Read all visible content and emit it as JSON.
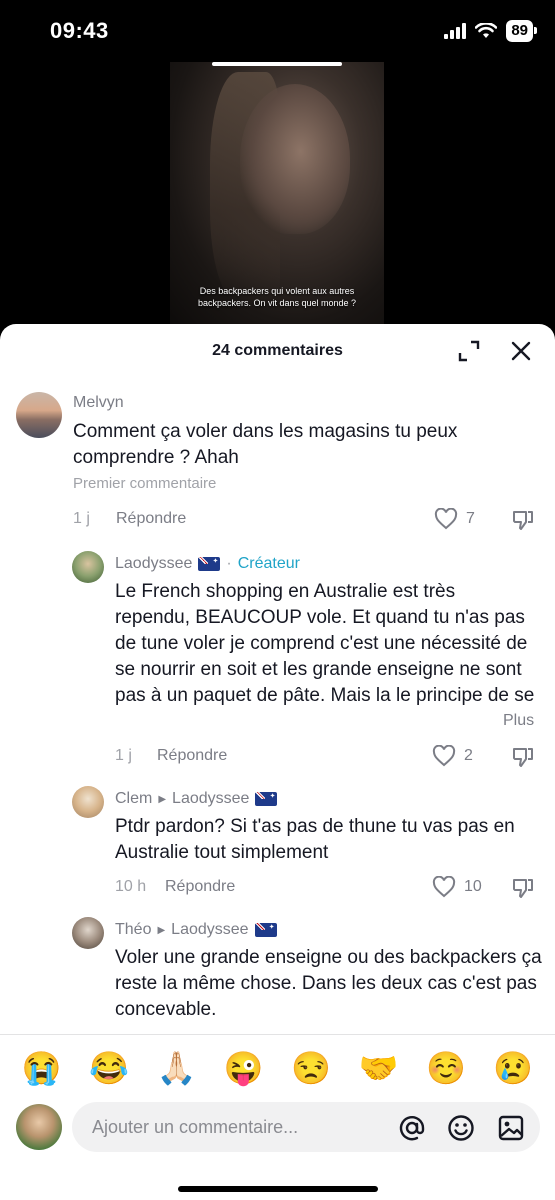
{
  "status_bar": {
    "time": "09:43",
    "battery": "89"
  },
  "video": {
    "caption": "Des backpackers qui volent aux autres backpackers. On vit dans quel monde ?"
  },
  "sheet": {
    "title": "24 commentaires"
  },
  "comments": [
    {
      "author": "Melvyn",
      "text": "Comment ça voler dans les magasins tu peux comprendre ? Ahah",
      "label": "Premier commentaire",
      "time": "1 j",
      "reply": "Répondre",
      "likes": "7"
    },
    {
      "author": "Laodyssee",
      "badge": "Créateur",
      "text": "Le French shopping en Australie est très rependu, BEAUCOUP vole. Et quand tu n'as pas de tune voler je comprend c'est une nécessité de se nourrir en soit et les grande enseigne ne sont pas à un paquet de pâte. Mais la le principe de se voler entre nous…",
      "more": "Plus",
      "time": "1 j",
      "reply": "Répondre",
      "likes": "2"
    },
    {
      "author": "Clem",
      "reply_to": "Laodyssee",
      "text": "Ptdr pardon? Si t'as pas de thune tu vas pas en Australie tout simplement",
      "time": "10 h",
      "reply": "Répondre",
      "likes": "10"
    },
    {
      "author": "Théo",
      "reply_to": "Laodyssee",
      "text": "Voler une grande enseigne ou des backpackers ça reste la même chose. Dans les deux cas c'est pas concevable."
    }
  ],
  "emojis": [
    "😭",
    "😂",
    "🙏🏻",
    "😜",
    "😒",
    "🤝",
    "☺️",
    "😢"
  ],
  "input": {
    "placeholder": "Ajouter un commentaire..."
  },
  "icons": {
    "mention": "@",
    "emoji": "smiley-icon",
    "image": "image-icon"
  }
}
